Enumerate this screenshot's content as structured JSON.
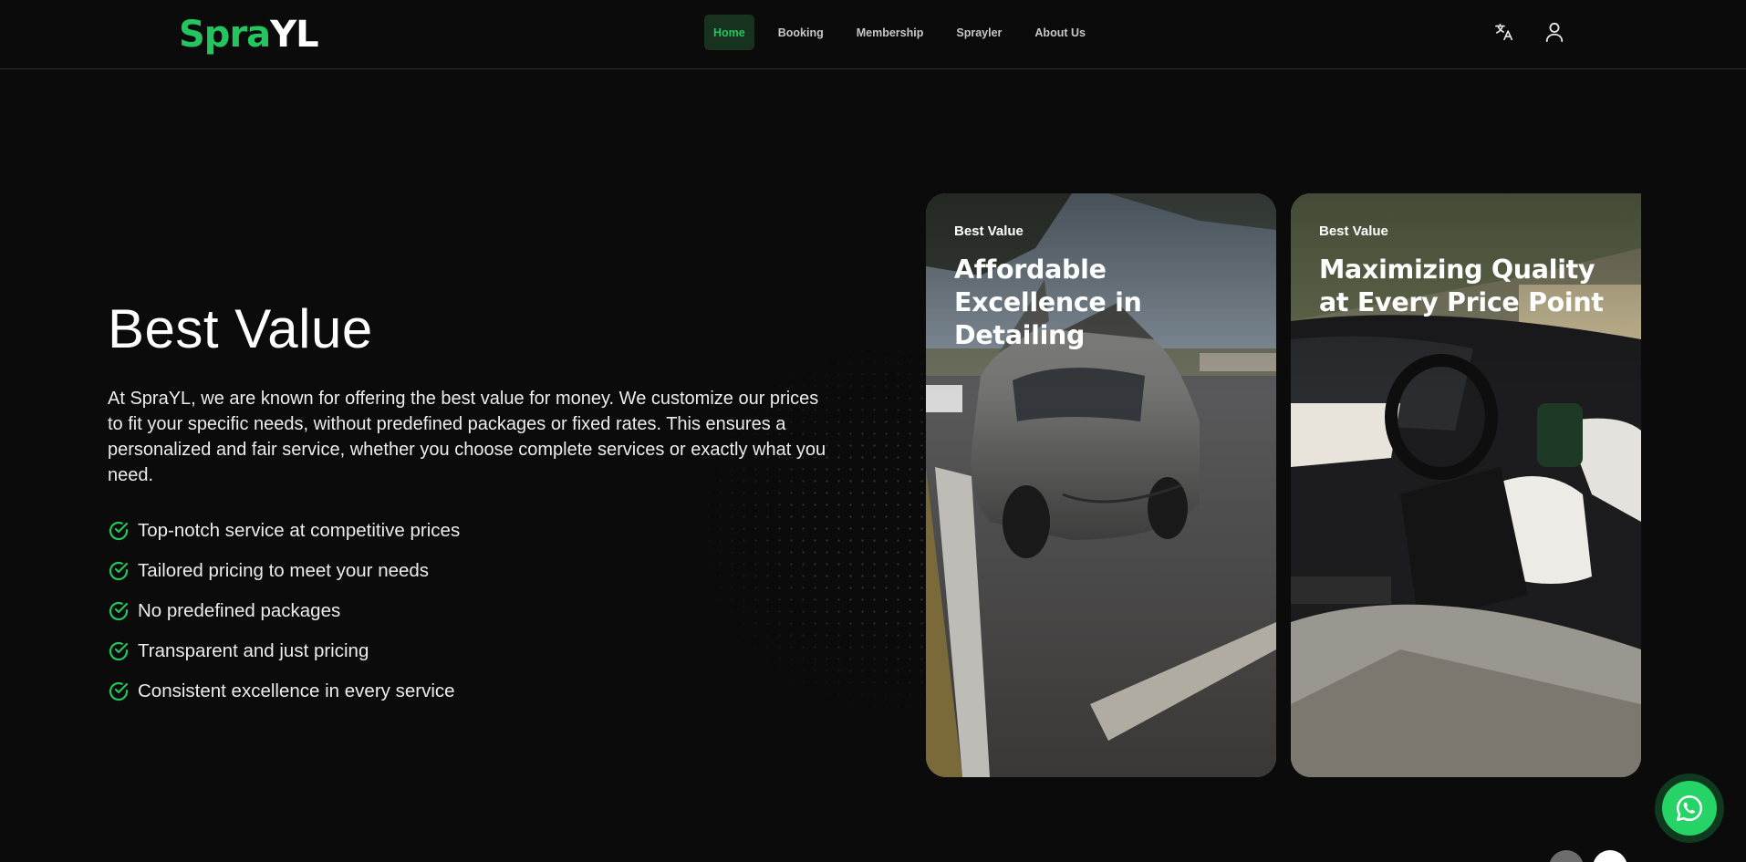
{
  "header": {
    "logo": {
      "part1": "Spra",
      "part2": "YL"
    },
    "nav": [
      {
        "label": "Home",
        "active": true
      },
      {
        "label": "Booking",
        "active": false
      },
      {
        "label": "Membership",
        "active": false
      },
      {
        "label": "Sprayler",
        "active": false
      },
      {
        "label": "About Us",
        "active": false
      }
    ],
    "icons": [
      "translate-icon",
      "user-icon"
    ]
  },
  "hero": {
    "title": "Best Value",
    "description": "At SpraYL, we are known for offering the best value for money. We customize our prices to fit your specific needs, without predefined packages or fixed rates. This ensures a personalized and fair service, whether you choose complete services or exactly what you need.",
    "features": [
      "Top-notch service at competitive prices",
      "Tailored pricing to meet your needs",
      "No predefined packages",
      "Transparent and just pricing",
      "Consistent excellence in every service"
    ]
  },
  "cards": [
    {
      "tag": "Best Value",
      "title": "Affordable Excellence in Detailing"
    },
    {
      "tag": "Best Value",
      "title": "Maximizing Quality at Every Price Point"
    }
  ],
  "colors": {
    "accent": "#22c55e",
    "background": "#0b0b0b",
    "whatsapp": "#25d366"
  },
  "floating": {
    "icon": "whatsapp-icon"
  }
}
